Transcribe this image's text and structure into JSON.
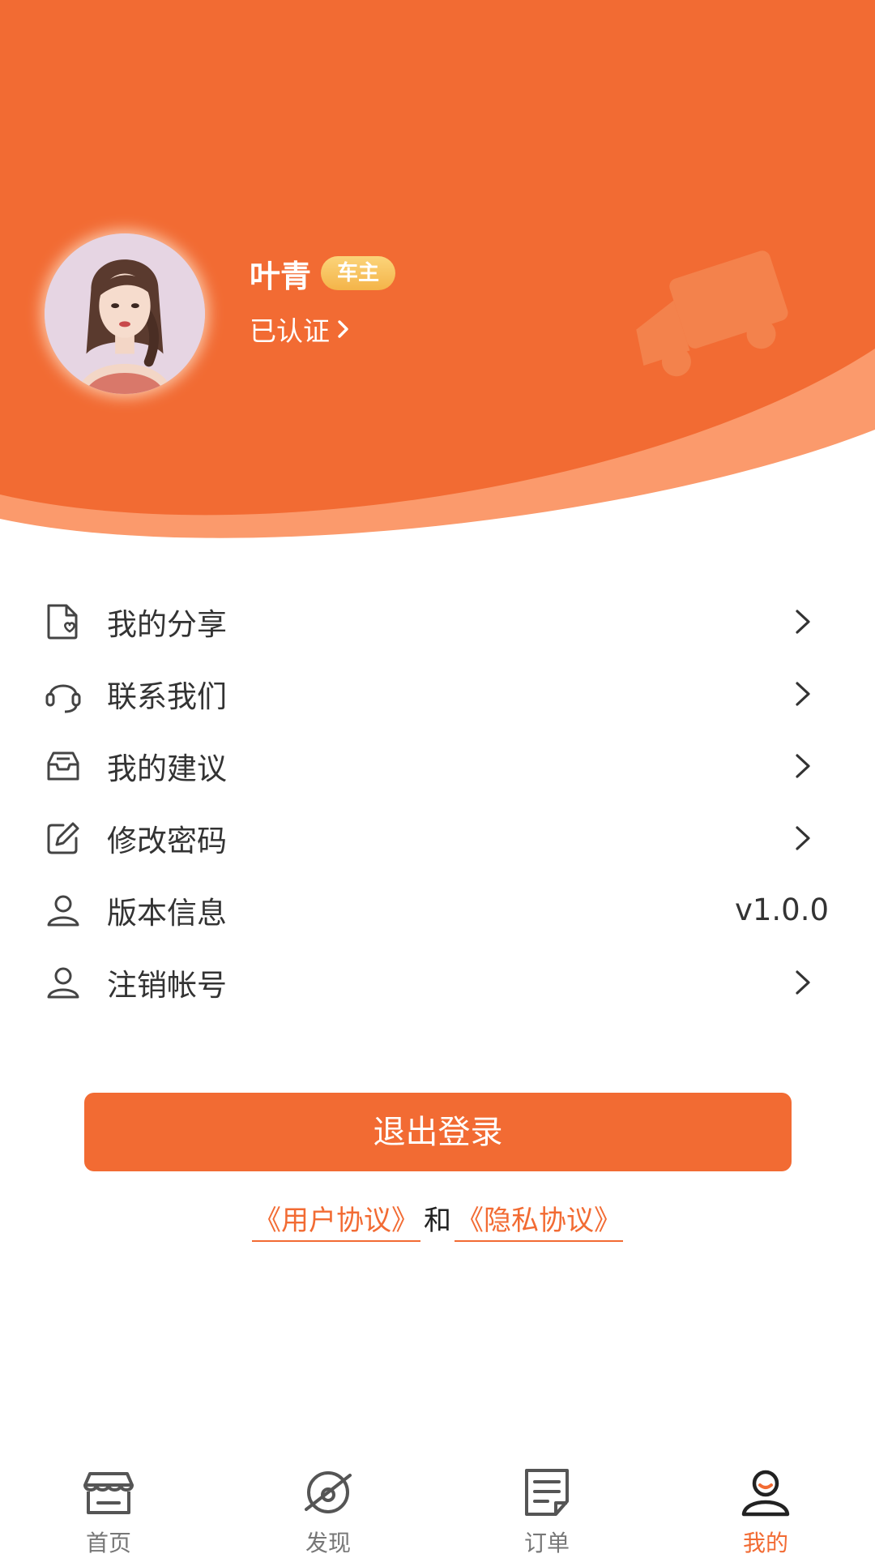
{
  "theme": {
    "accent": "#f26b33",
    "header_bg": "#f26b33",
    "header_wave_light": "#fb9a6c",
    "badge_gold": "#f4b449"
  },
  "profile": {
    "name": "叶青",
    "role_badge": "车主",
    "verify_status": "已认证",
    "verify_icon": "chevron-right-icon",
    "header_decoration": "truck-icon"
  },
  "menu": {
    "items": [
      {
        "label": "我的分享",
        "icon": "file-heart-icon",
        "trailing": "chevron-right-icon"
      },
      {
        "label": "联系我们",
        "icon": "headset-icon",
        "trailing": "chevron-right-icon"
      },
      {
        "label": "我的建议",
        "icon": "inbox-icon",
        "trailing": "chevron-right-icon"
      },
      {
        "label": "修改密码",
        "icon": "edit-icon",
        "trailing": "chevron-right-icon"
      },
      {
        "label": "版本信息",
        "icon": "user-icon",
        "value": "v1.0.0"
      },
      {
        "label": "注销帐号",
        "icon": "user-icon",
        "trailing": "chevron-right-icon"
      }
    ]
  },
  "logout": {
    "label": "退出登录"
  },
  "agreement": {
    "user_agreement": "《用户协议》",
    "connector": "和",
    "privacy_agreement": "《隐私协议》"
  },
  "tabbar": {
    "tabs": [
      {
        "label": "首页",
        "icon": "store-icon",
        "active": false
      },
      {
        "label": "发现",
        "icon": "compass-icon",
        "active": false
      },
      {
        "label": "订单",
        "icon": "order-icon",
        "active": false
      },
      {
        "label": "我的",
        "icon": "user-icon",
        "active": true
      }
    ]
  }
}
